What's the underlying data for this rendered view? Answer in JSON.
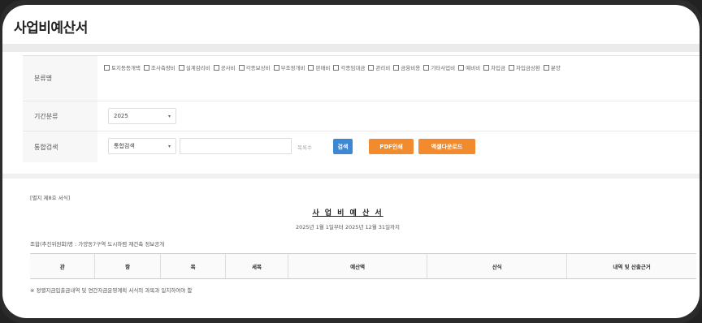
{
  "page": {
    "title": "사업비예산서"
  },
  "filters": {
    "category": {
      "label": "분류명",
      "options": [
        "토지등등개택",
        "조사측량비",
        "설계감리비",
        "공사비",
        "각종보상비",
        "부조정개비",
        "판매비",
        "각종임대금",
        "관리비",
        "금융비용",
        "기타사업비",
        "예비비",
        "차입금",
        "차입금상환",
        "분양"
      ]
    },
    "year": {
      "label": "기간분류",
      "value": "2025"
    },
    "search": {
      "label": "통합검색",
      "select_value": "통합검색",
      "input_value": "",
      "hint": "목록수",
      "search_button": "검색",
      "pdf_button": "PDF인쇄",
      "excel_button": "엑셀다운로드"
    }
  },
  "document": {
    "form_label": "[별지 제8호 서식]",
    "title": "사 업 비 예 산 서",
    "period": "2025년 1월 1일부터 2025년 12월 31일까지",
    "org": "조합(추진위원회)명 : 가양동7구역 도시하렴 재건축 정보공개",
    "columns": [
      "관",
      "항",
      "목",
      "세목",
      "예산액",
      "산식",
      "내역 및 산출근거"
    ],
    "note": "※ 정렬지금입출금내역 및 연간자금운영계획 서식의 과목과 일치하여야 함"
  },
  "colors": {
    "accent_blue": "#3e87d3",
    "accent_orange": "#f28a2e"
  }
}
